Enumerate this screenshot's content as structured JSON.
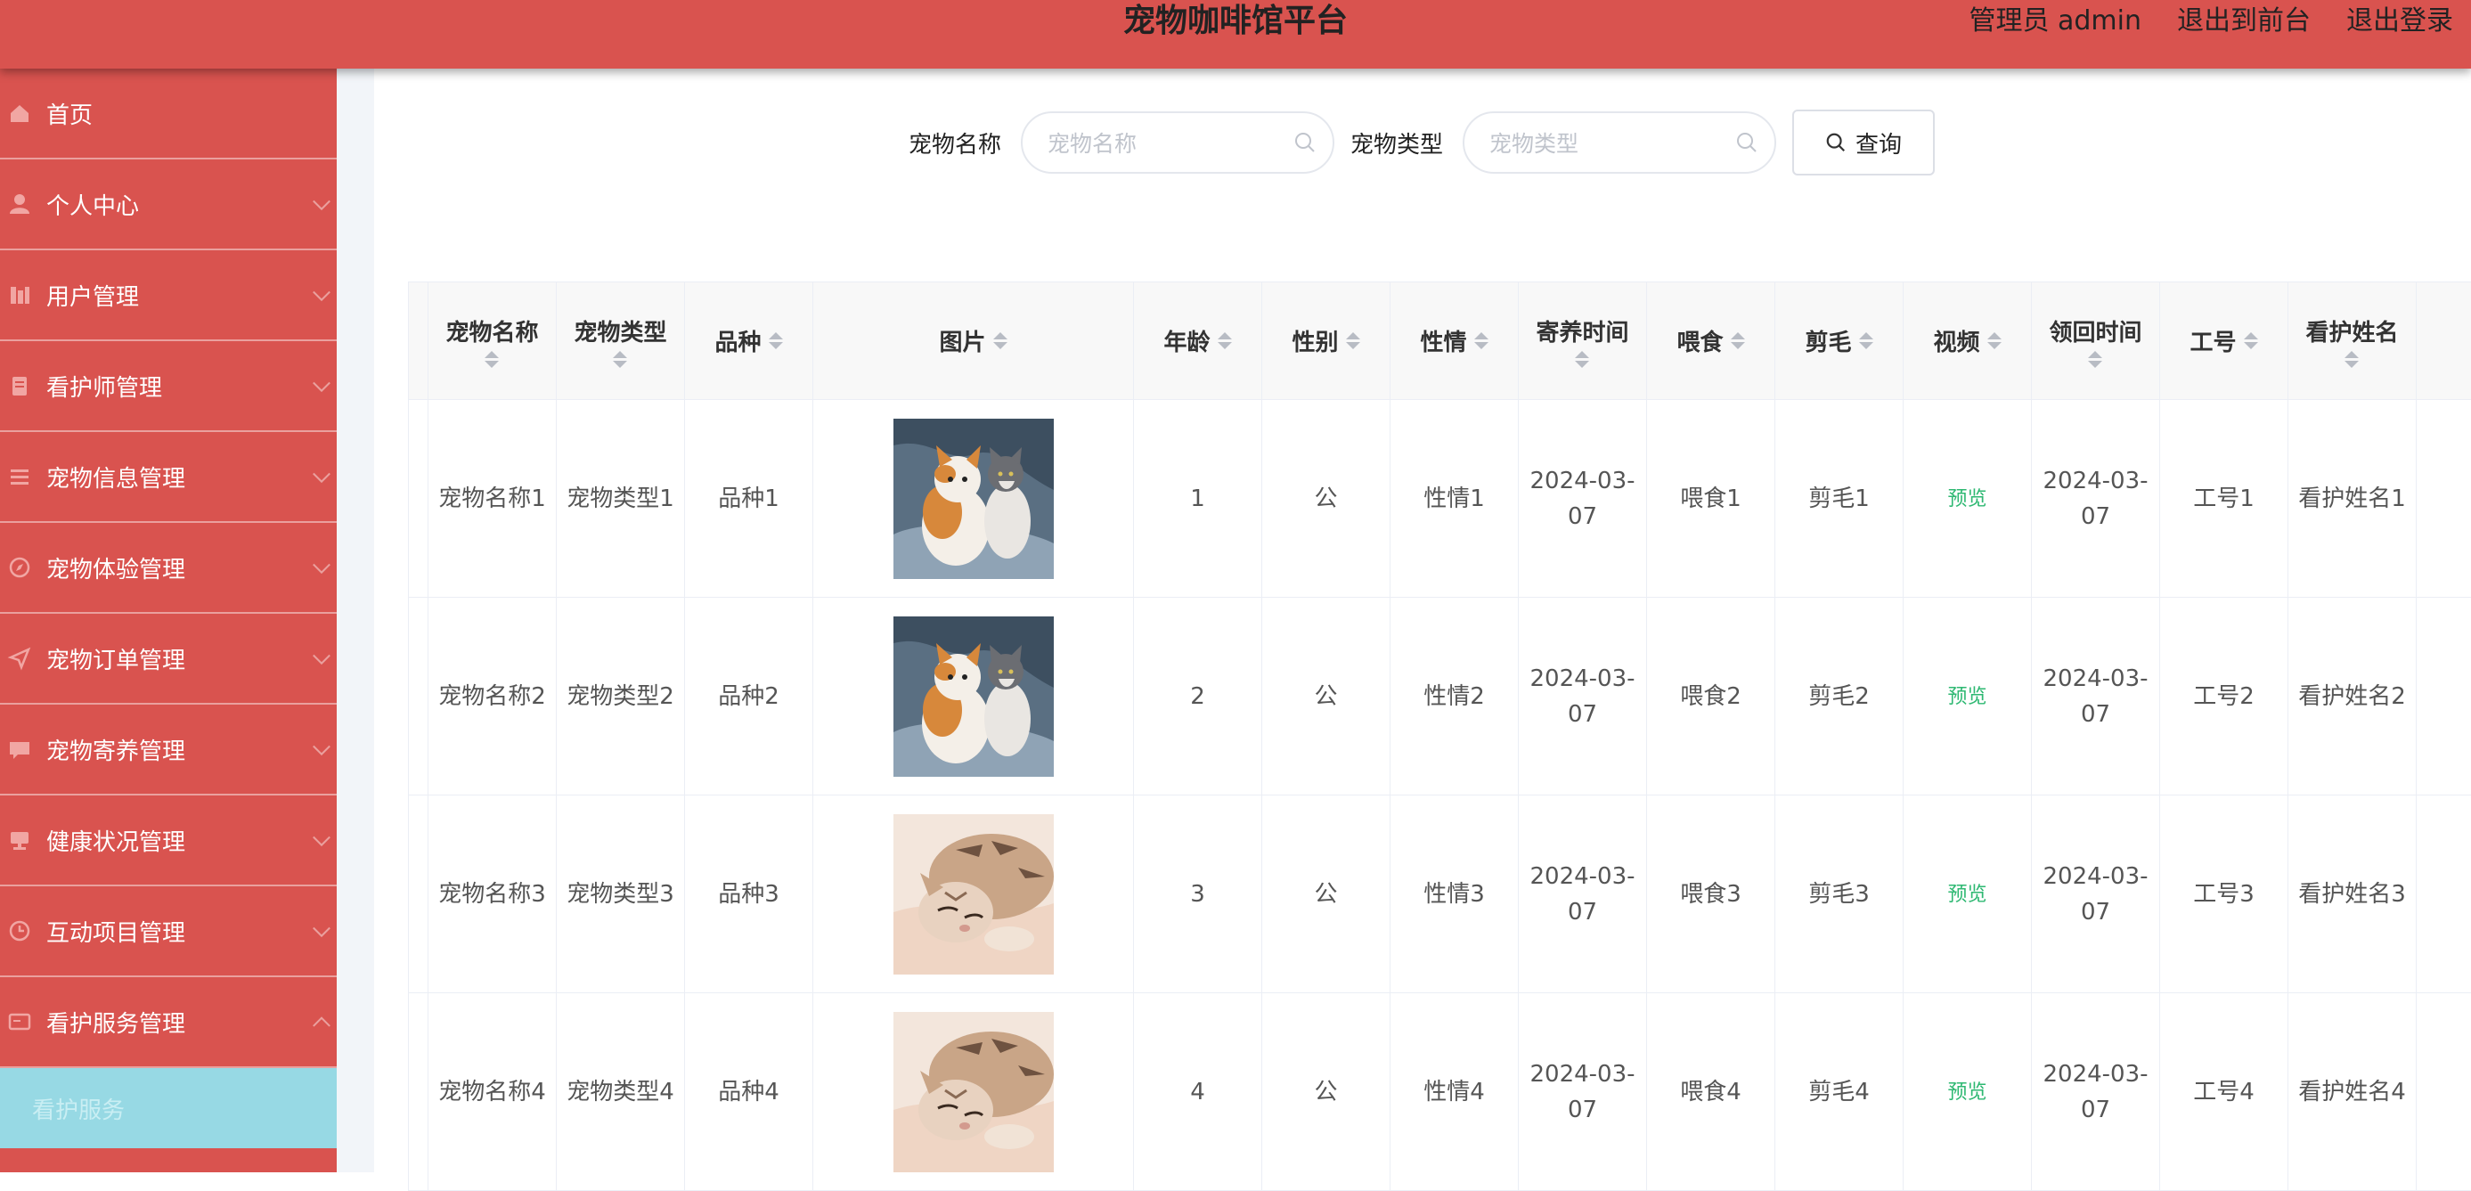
{
  "header": {
    "title": "宠物咖啡馆平台",
    "admin_label": "管理员 admin",
    "to_front": "退出到前台",
    "logout": "退出登录"
  },
  "sidebar": {
    "items": [
      {
        "label": "首页",
        "icon": "home-icon",
        "has_chevron": false
      },
      {
        "label": "个人中心",
        "icon": "user-icon",
        "has_chevron": true
      },
      {
        "label": "用户管理",
        "icon": "users-icon",
        "has_chevron": true
      },
      {
        "label": "看护师管理",
        "icon": "nurse-icon",
        "has_chevron": true
      },
      {
        "label": "宠物信息管理",
        "icon": "list-icon",
        "has_chevron": true
      },
      {
        "label": "宠物体验管理",
        "icon": "compass-icon",
        "has_chevron": true
      },
      {
        "label": "宠物订单管理",
        "icon": "send-icon",
        "has_chevron": true
      },
      {
        "label": "宠物寄养管理",
        "icon": "chat-icon",
        "has_chevron": true
      },
      {
        "label": "健康状况管理",
        "icon": "monitor-icon",
        "has_chevron": true
      },
      {
        "label": "互动项目管理",
        "icon": "clock-icon",
        "has_chevron": true
      },
      {
        "label": "看护服务管理",
        "icon": "card-icon",
        "has_chevron": true,
        "expanded": true
      }
    ],
    "submenu_active": "看护服务"
  },
  "search": {
    "name_label": "宠物名称",
    "name_placeholder": "宠物名称",
    "type_label": "宠物类型",
    "type_placeholder": "宠物类型",
    "button_label": "查询"
  },
  "table": {
    "headers": [
      "宠物名称",
      "宠物类型",
      "品种",
      "图片",
      "年龄",
      "性别",
      "性情",
      "寄养时间",
      "喂食",
      "剪毛",
      "视频",
      "领回时间",
      "工号",
      "看护姓名"
    ],
    "rows": [
      {
        "name": "宠物名称1",
        "type": "宠物类型1",
        "breed": "品种1",
        "image": "cat-pair",
        "age": "1",
        "sex": "公",
        "temper": "性情1",
        "foster": "2024-03-07",
        "feed": "喂食1",
        "groom": "剪毛1",
        "video": "预览",
        "return": "2024-03-07",
        "staff_no": "工号1",
        "caretaker": "看护姓名1"
      },
      {
        "name": "宠物名称2",
        "type": "宠物类型2",
        "breed": "品种2",
        "image": "cat-pair",
        "age": "2",
        "sex": "公",
        "temper": "性情2",
        "foster": "2024-03-07",
        "feed": "喂食2",
        "groom": "剪毛2",
        "video": "预览",
        "return": "2024-03-07",
        "staff_no": "工号2",
        "caretaker": "看护姓名2"
      },
      {
        "name": "宠物名称3",
        "type": "宠物类型3",
        "breed": "品种3",
        "image": "sleeping-cat",
        "age": "3",
        "sex": "公",
        "temper": "性情3",
        "foster": "2024-03-07",
        "feed": "喂食3",
        "groom": "剪毛3",
        "video": "预览",
        "return": "2024-03-07",
        "staff_no": "工号3",
        "caretaker": "看护姓名3"
      },
      {
        "name": "宠物名称4",
        "type": "宠物类型4",
        "breed": "品种4",
        "image": "sleeping-cat",
        "age": "4",
        "sex": "公",
        "temper": "性情4",
        "foster": "2024-03-07",
        "feed": "喂食4",
        "groom": "剪毛4",
        "video": "预览",
        "return": "2024-03-07",
        "staff_no": "工号4",
        "caretaker": "看护姓名4"
      }
    ]
  },
  "colors": {
    "primary": "#d9534f",
    "submenu_active_bg": "#97d9e4",
    "preview_link": "#2eb872"
  }
}
